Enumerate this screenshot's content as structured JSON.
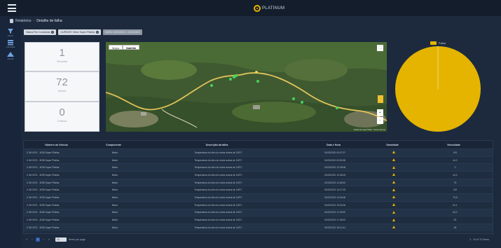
{
  "header": {
    "logo_text": "PLATINUM"
  },
  "sidebar": {
    "items": [
      {
        "icon": "filter-icon",
        "label": "Filtros"
      },
      {
        "icon": "layers-icon",
        "label": "Camadas"
      },
      {
        "icon": "alert-icon",
        "label": "Alertas"
      }
    ]
  },
  "breadcrumb": {
    "parent": "Relatórios",
    "separator": "-",
    "current": "Detalhe de falha"
  },
  "filters": [
    {
      "label": "Status Fim Concluída"
    },
    {
      "label": "CURSOR: Setor Super Platina"
    },
    {
      "label": "DATA: 01/01/2021 - 01/11/2021"
    }
  ],
  "kpis": [
    {
      "value": "1",
      "label": "Veículos"
    },
    {
      "value": "72",
      "label": "Avisos"
    },
    {
      "value": "0",
      "label": "Críticos"
    }
  ],
  "map": {
    "btn_map": "Mapa",
    "btn_satellite": "Satélite",
    "fullscreen": "⛶",
    "zoom_in": "+",
    "zoom_out": "−",
    "attribution": "Dados do mapa ©2021 · Termos de Uso"
  },
  "pie": {
    "legend_label": "Falha",
    "color": "#e4b400"
  },
  "chart_data": {
    "type": "pie",
    "categories": [
      "Falha"
    ],
    "values": [
      100
    ],
    "title": ""
  },
  "table": {
    "columns": [
      "Número do Veículo",
      "Componente",
      "Descrição da falha",
      "Data e Hora",
      "Gravidade",
      "Velocidade"
    ],
    "rows": [
      [
        "0 JM 0074 - 3038 Super Platina",
        "Motor",
        "Temperatura do óleo do motor acima de 118°C",
        "01/03/2021 09:37:37",
        "warn",
        "151"
      ],
      [
        "0 JM 0074 - 3038 Super Platina",
        "Motor",
        "Temperatura do óleo do motor acima de 118°C",
        "01/03/2021 09:53:38",
        "warn",
        "44,2"
      ],
      [
        "0 JM 0074 - 3038 Super Platina",
        "Motor",
        "Temperatura do óleo do motor acima de 118°C",
        "01/03/2021 10:28:08",
        "warn",
        "0"
      ],
      [
        "0 JM 0074 - 3038 Super Platina",
        "Motor",
        "Temperatura do óleo do motor acima de 118°C",
        "01/03/2021 10:48:15",
        "warn",
        "44,2"
      ],
      [
        "0 JM 0074 - 3038 Super Platina",
        "Motor",
        "Temperatura do óleo do motor acima de 118°C",
        "01/03/2021 11:48:33",
        "warn",
        "75"
      ],
      [
        "0 JM 0074 - 3038 Super Platina",
        "Motor",
        "Temperatura do óleo do motor acima de 118°C",
        "01/03/2021 13:17:03",
        "warn",
        "122"
      ],
      [
        "0 JM 0074 - 3038 Super Platina",
        "Motor",
        "Temperatura do óleo do motor acima de 118°C",
        "01/03/2021 14:04:08",
        "warn",
        "73,5"
      ],
      [
        "0 JM 0074 - 3038 Super Platina",
        "Motor",
        "Temperatura do óleo do motor acima de 118°C",
        "01/03/2021 15:04:06",
        "warn",
        "61,1"
      ],
      [
        "0 JM 0074 - 3038 Super Platina",
        "Motor",
        "Temperatura do óleo do motor acima de 118°C",
        "01/03/2021 17:03:02",
        "warn",
        "53,2"
      ],
      [
        "0 JM 0074 - 3038 Super Platina",
        "Motor",
        "Temperatura do óleo do motor acima de 118°C",
        "01/03/2021 17:48:22",
        "warn",
        "52"
      ],
      [
        "0 JM 0074 - 3038 Super Platina",
        "Motor",
        "Temperatura do óleo do motor acima de 118°C",
        "01/03/2021 18:10:41",
        "warn",
        "48"
      ]
    ]
  },
  "pager": {
    "first": "«",
    "prev": "‹",
    "page": "1",
    "next": "›",
    "last": "»",
    "page_size": "10",
    "page_size_label": "items per page",
    "range": "1 - 10 of 72 items"
  }
}
